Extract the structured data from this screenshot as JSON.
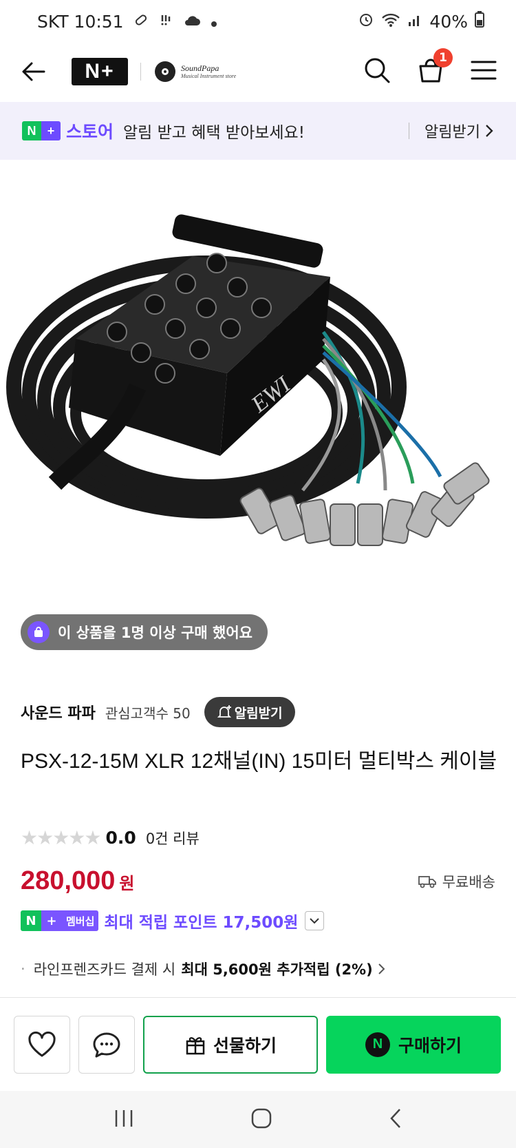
{
  "status_bar": {
    "carrier_time": "SKT 10:51",
    "battery": "40%"
  },
  "header": {
    "store_logo_line1": "SoundPapa",
    "store_logo_line2": "Musical Instrument store",
    "cart_count": "1"
  },
  "notice": {
    "store_word": "스토어",
    "message": "알림 받고 혜택 받아보세요!",
    "alarm_label": "알림받기"
  },
  "product": {
    "bought_badge": "이 상품을 1명 이상 구매 했어요",
    "seller_name": "사운드 파파",
    "followers": "관심고객수 50",
    "notify_label": "알림받기",
    "title": "PSX-12-15M XLR 12채널(IN) 15미터 멀티박스 케이블",
    "rating_value": "0.0",
    "review_count": "0건 리뷰",
    "rating_stars": 0,
    "price": "280,000",
    "price_unit": "원",
    "shipping": "무료배송",
    "member_tag": "멤버십",
    "points": "최대 적립 포인트 17,500원",
    "benefit_prefix": "라인프렌즈카드 결제 시",
    "benefit_bold": "최대 5,600원 추가적립 (2%)"
  },
  "actions": {
    "gift_label": "선물하기",
    "buy_label": "구매하기"
  },
  "colors": {
    "accent_purple": "#6d4bff",
    "price_red": "#c8102e",
    "buy_green": "#06d45c"
  }
}
